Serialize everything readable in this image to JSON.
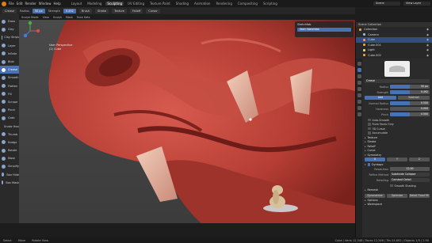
{
  "app": {
    "menus": [
      "File",
      "Edit",
      "Render",
      "Window",
      "Help"
    ],
    "workspace_tabs": [
      "Layout",
      "Modeling",
      "Sculpting",
      "UV Editing",
      "Texture Paint",
      "Shading",
      "Animation",
      "Rendering",
      "Compositing",
      "Scripting"
    ],
    "active_tab": "Sculpting",
    "scene": "Scene",
    "view_layer": "View Layer"
  },
  "tool_header": {
    "brush": "Crease",
    "radius_label": "Radius",
    "radius_value": "50 px",
    "strength_label": "Strength",
    "strength_value": "0.492",
    "buttons": [
      "Brush",
      "Stroke",
      "Texture",
      "Falloff",
      "Cursor"
    ]
  },
  "sub_header": [
    "Sculpt Mode",
    "View",
    "Sculpt",
    "Mask",
    "Face Sets"
  ],
  "viewport_info": {
    "line1": "User Perspective",
    "line2": "(1) Cube"
  },
  "n_panel": {
    "title": "Sketchfab",
    "button": "Start Sketchfab"
  },
  "tools": [
    "Draw",
    "Clay",
    "Clay Strips",
    "Layer",
    "Inflate",
    "Blob",
    "Crease",
    "Smooth",
    "Flatten",
    "Fill",
    "Scrape",
    "Pinch",
    "Grab",
    "Snake Hook",
    "Thumb",
    "Nudge",
    "Rotate",
    "Mask",
    "Simplify",
    "Box Hide",
    "Box Mask"
  ],
  "active_tool_index": 6,
  "outliner": {
    "header": "Scene Collection",
    "items": [
      {
        "name": "Collection",
        "kind": "coll",
        "selected": false
      },
      {
        "name": "Camera",
        "kind": "cam",
        "selected": false
      },
      {
        "name": "Cube",
        "kind": "mesh",
        "selected": true
      },
      {
        "name": "Cube.001",
        "kind": "mesh",
        "selected": false
      },
      {
        "name": "Light",
        "kind": "lamp",
        "selected": false
      },
      {
        "name": "Cube.002",
        "kind": "mesh",
        "selected": false
      }
    ]
  },
  "properties": {
    "brush_name": "Crease",
    "radius": {
      "label": "Radius",
      "value": "50 px",
      "fraction": 0.5
    },
    "strength": {
      "label": "Strength",
      "value": "0.492",
      "fraction": 0.49
    },
    "direction": {
      "add": "Add",
      "subtract": "Subtract"
    },
    "normal_radius": {
      "label": "Normal Radius",
      "value": "0.500",
      "fraction": 0.5
    },
    "hardness": {
      "label": "Hardness",
      "value": "0.000",
      "fraction": 0.0
    },
    "pinch": {
      "label": "Pinch",
      "value": "0.500",
      "fraction": 0.5
    },
    "checks": [
      "Auto-Smooth",
      "Front Faces Only",
      "3D Cursor",
      "Accumulate"
    ],
    "sections": [
      "Texture",
      "Stroke",
      "Falloff",
      "Curve"
    ],
    "symmetry": "Symmetry",
    "symmetry_axes": [
      "X",
      "Y",
      "Z"
    ],
    "dyntopo": "Dyntopo",
    "resolution_label": "Resolution",
    "resolution_value": "12.00",
    "refine_label": "Refine Method",
    "refine_value": "Subdivide Collapse",
    "detailing_label": "Detailing",
    "detailing_value": "Constant Detail",
    "smooth_shading": "Smooth Shading",
    "remesh": "Remesh",
    "bottom_buttons": [
      "Symmetrize",
      "Optimize",
      "Detail Flood Fill"
    ],
    "options": "Options",
    "workspace": "Workspace"
  },
  "status_bar": {
    "left": [
      "Select",
      "Move",
      "Rotate View"
    ],
    "right": "Cube | Verts 12,348 | Faces 12,346 | Tris 24,692 | Objects 1/5 | 2.90"
  },
  "colors": {
    "accent": "#4772b3",
    "skin": "#c2473d",
    "background": "#444444"
  }
}
